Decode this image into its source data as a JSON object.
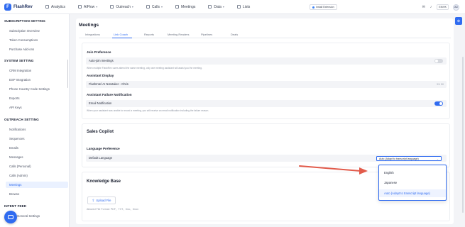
{
  "app": {
    "brand": "FlashRev"
  },
  "topnav": {
    "items": [
      {
        "label": "Analytics",
        "dropdown": false
      },
      {
        "label": "AIFlow",
        "dropdown": true
      },
      {
        "label": "Outreach",
        "dropdown": true
      },
      {
        "label": "Calls",
        "dropdown": true
      },
      {
        "label": "Meetings",
        "dropdown": false
      },
      {
        "label": "Data",
        "dropdown": true
      },
      {
        "label": "Lists",
        "dropdown": false
      }
    ],
    "install_extension": "Install Extension",
    "lang": "EN/HK",
    "avatar_initials": "AD"
  },
  "sidebar": {
    "groups": [
      {
        "title": "SUBSCRIPTION SETTING",
        "items": [
          "Subscription Overview",
          "Token Consumptions",
          "Purchase Add-ons"
        ]
      },
      {
        "title": "SYSTEM SETTING",
        "items": [
          "CRM Integration",
          "ESP Integration",
          "Phone Country Code Settings",
          "Exports",
          "API Keys"
        ]
      },
      {
        "title": "OUTREACH SETTING",
        "items": [
          "Notifications",
          "Sequences",
          "Emails",
          "Messages",
          "Calls (Personal)",
          "Calls (Admin)",
          "Meetings",
          "Browse"
        ]
      },
      {
        "title": "INTENT FEED",
        "items": [
          "General Settings"
        ]
      }
    ],
    "active_item": "Meetings"
  },
  "page": {
    "title": "Meetings",
    "tabs": [
      "Integrations",
      "Link Coach",
      "Reports",
      "Meeting Readers",
      "Pipelines",
      "Deals"
    ],
    "active_tab": "Link Coach"
  },
  "join_preference": {
    "label": "Join Preference",
    "auto_join_label": "Auto-join meetings",
    "auto_join_on": false,
    "hint": "When multiple FlashRev users attend the same meeting, only one meeting assistant will assist you the meeting."
  },
  "assistant_display": {
    "label": "Assistant Display",
    "value": "FlashIntel AI Notetaker - Chris",
    "count": "31/ 50"
  },
  "assistant_failure": {
    "label": "Assistant Failure Notification",
    "email_label": "Email Notification",
    "email_on": true,
    "hint": "When your assistant was unable to record a meeting, you will receive an email notification including the failure reason."
  },
  "sales_copilot": {
    "title": "Sales Copilot",
    "language_pref_label": "Language Preference",
    "default_language_label": "Default Language",
    "selected": "Auto (Adapt to transcript language)",
    "options": [
      "English",
      "Japanese",
      "Auto (Adapt to transcript language)"
    ]
  },
  "knowledge_base": {
    "title": "Knowledge Base",
    "upload_label": "Upload File",
    "formats": "Allowed File Format: PDF、TXT、Doc、Docx"
  },
  "colors": {
    "accent": "#2f6bf0",
    "arrow": "#e25b4b"
  },
  "icons": {
    "chat": "chat-icon",
    "settings": "gear-icon",
    "right_panel": "panel-icon"
  }
}
